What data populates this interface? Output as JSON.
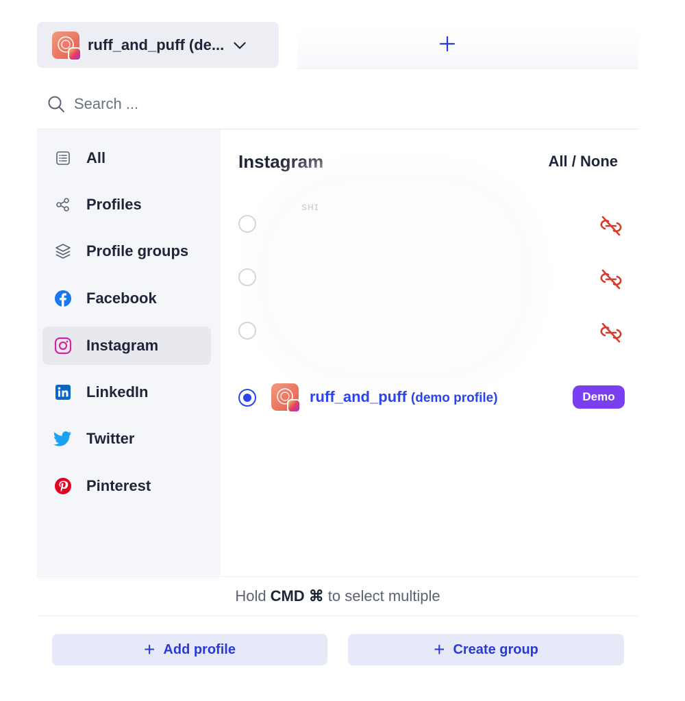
{
  "header": {
    "selected_profile": "ruff_and_puff (de...",
    "add_tab_label": "+"
  },
  "search": {
    "placeholder": "Search ..."
  },
  "sidebar": {
    "items": [
      {
        "label": "All",
        "icon": "list-icon"
      },
      {
        "label": "Profiles",
        "icon": "share-nodes-icon"
      },
      {
        "label": "Profile groups",
        "icon": "layers-icon"
      },
      {
        "label": "Facebook",
        "icon": "facebook-icon"
      },
      {
        "label": "Instagram",
        "icon": "instagram-icon",
        "active": true
      },
      {
        "label": "LinkedIn",
        "icon": "linkedin-icon"
      },
      {
        "label": "Twitter",
        "icon": "twitter-icon"
      },
      {
        "label": "Pinterest",
        "icon": "pinterest-icon"
      }
    ]
  },
  "main": {
    "section_title": "Instagram",
    "all_none": "All / None",
    "redacted_text": "ѕнɪ",
    "account": {
      "name": "ruff_and_puff",
      "suffix": "(demo profile)",
      "badge": "Demo",
      "selected": true
    }
  },
  "footer": {
    "hint_prefix": "Hold",
    "hint_key": "CMD ⌘",
    "hint_suffix": "to select multiple",
    "add_profile": "Add profile",
    "create_group": "Create group",
    "plus_glyph": "+"
  },
  "colors": {
    "accent": "#2a44f0",
    "demo_badge": "#7b3ff2",
    "unlink_red": "#d83a2e",
    "button_bg": "#e6e9f8"
  }
}
